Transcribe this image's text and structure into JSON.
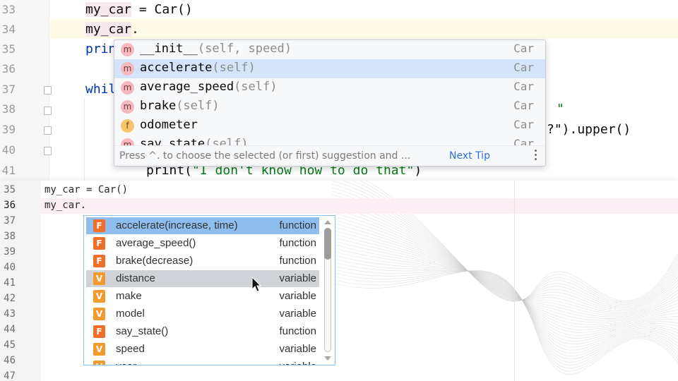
{
  "top_editor": {
    "line_numbers": [
      "33",
      "34",
      "35",
      "36",
      "37",
      "38",
      "39",
      "40",
      "41"
    ],
    "code": {
      "line33": {
        "var": "my_car",
        "rest": " = Car()"
      },
      "line34": {
        "var": "my_car",
        "rest": "."
      },
      "line35": "print",
      "line37": "while",
      "line38_tail": "\"",
      "line39_tail": "?\").upper()",
      "line41_fn": "print(",
      "line41_str": "\"I don't know how to do that\"",
      "line41_close": ")"
    },
    "completion_popup": {
      "items": [
        {
          "kind": "m",
          "name": "__init__",
          "signature": "(self, speed)",
          "type": "Car"
        },
        {
          "kind": "m",
          "name": "accelerate",
          "signature": "(self)",
          "type": "Car",
          "selected": true
        },
        {
          "kind": "m",
          "name": "average_speed",
          "signature": "(self)",
          "type": "Car"
        },
        {
          "kind": "m",
          "name": "brake",
          "signature": "(self)",
          "type": "Car"
        },
        {
          "kind": "f",
          "name": "odometer",
          "signature": "",
          "type": "Car"
        },
        {
          "kind": "m",
          "name": "say_state",
          "signature": "(self)",
          "type": "Car"
        }
      ],
      "hint": "Press ^. to choose the selected (or first) suggestion and ...",
      "next_tip": "Next Tip"
    }
  },
  "bottom_editor": {
    "line_numbers": [
      "35",
      "36",
      "37",
      "38",
      "39",
      "40",
      "41",
      "42",
      "43",
      "44",
      "45",
      "46",
      "47"
    ],
    "active_line": "36",
    "code": {
      "line35": "my_car = Car()",
      "line36": "my_car."
    },
    "completion_popup": {
      "items": [
        {
          "kind": "F",
          "name": "accelerate(increase, time)",
          "type": "function",
          "state": "selected"
        },
        {
          "kind": "F",
          "name": "average_speed()",
          "type": "function"
        },
        {
          "kind": "F",
          "name": "brake(decrease)",
          "type": "function"
        },
        {
          "kind": "V",
          "name": "distance",
          "type": "variable",
          "state": "hover"
        },
        {
          "kind": "V",
          "name": "make",
          "type": "variable"
        },
        {
          "kind": "V",
          "name": "model",
          "type": "variable"
        },
        {
          "kind": "F",
          "name": "say_state()",
          "type": "function"
        },
        {
          "kind": "V",
          "name": "speed",
          "type": "variable"
        },
        {
          "kind": "V",
          "name": "year",
          "type": "variable"
        }
      ]
    }
  },
  "colors": {
    "selected_top": "#d5e4fb",
    "selected_bottom": "#8fbdee",
    "hover_bottom": "#d0d3d7",
    "badge_function": "#ee6e2a",
    "badge_variable": "#f39a2e",
    "keyword": "#0033b3",
    "string": "#067d17"
  },
  "icons": [
    "method-badge-icon",
    "field-badge-icon",
    "function-badge-icon",
    "variable-badge-icon",
    "more-options-icon",
    "scroll-up-icon",
    "scroll-down-icon",
    "mouse-pointer-icon"
  ]
}
